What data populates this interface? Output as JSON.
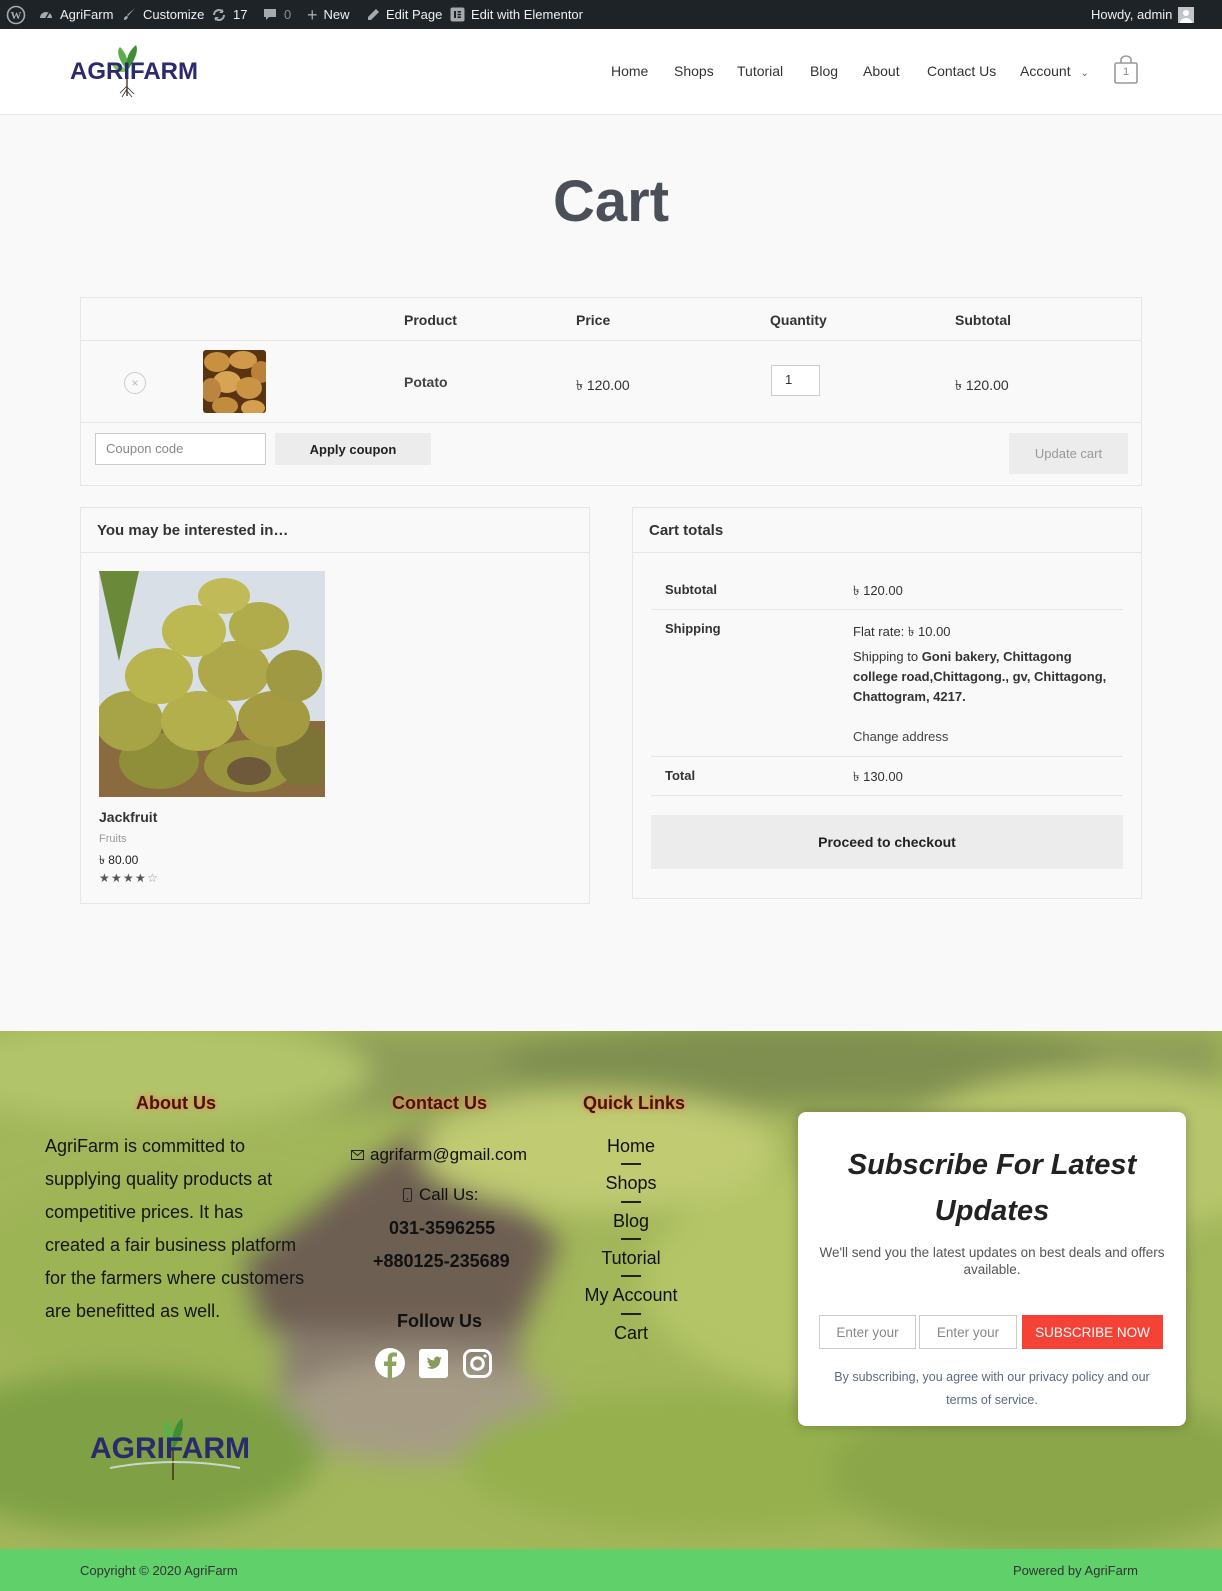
{
  "adminbar": {
    "site_name": "AgriFarm",
    "customize": "Customize",
    "updates_count": "17",
    "comments_count": "0",
    "new_label": "New",
    "edit_page": "Edit Page",
    "edit_elementor": "Edit with Elementor",
    "howdy": "Howdy, admin"
  },
  "header": {
    "logo_text": "AGRIFARM",
    "nav": [
      "Home",
      "Shops",
      "Tutorial",
      "Blog",
      "About",
      "Contact Us",
      "Account"
    ],
    "cart_count": "1"
  },
  "page_title": "Cart",
  "cart_table": {
    "headers": [
      "Product",
      "Price",
      "Quantity",
      "Subtotal"
    ],
    "row": {
      "remove_symbol": "×",
      "product": "Potato",
      "price": "৳ 120.00",
      "quantity": "1",
      "subtotal": "৳ 120.00"
    },
    "coupon_placeholder": "Coupon code",
    "apply_coupon": "Apply coupon",
    "update_cart": "Update cart"
  },
  "interested": {
    "title": "You may be interested in…",
    "product": {
      "name": "Jackfruit",
      "category": "Fruits",
      "price": "৳ 80.00",
      "rating": 4,
      "rating_max": 5
    }
  },
  "cart_totals": {
    "title": "Cart totals",
    "subtotal_label": "Subtotal",
    "subtotal_value": "৳ 120.00",
    "shipping_label": "Shipping",
    "flat_rate_label": "Flat rate:",
    "flat_rate_value": "৳ 10.00",
    "shipping_to_label": "Shipping to",
    "shipping_address": "Goni bakery, Chittagong college road,Chittagong., gv, Chittagong, Chattogram, 4217.",
    "change_address": "Change address",
    "total_label": "Total",
    "total_value": "৳ 130.00",
    "checkout_button": "Proceed to checkout"
  },
  "footer": {
    "about_title": "About Us",
    "about_text": "AgriFarm is committed to supplying quality products at competitive prices. It has created a fair business platform for the farmers where customers are benefitted as well.",
    "contact_title": "Contact Us",
    "email": "agrifarm@gmail.com",
    "call_label": "Call Us:",
    "phone1": "031-3596255",
    "phone2": "+880125-235689",
    "follow_title": "Follow Us",
    "quick_title": "Quick Links",
    "quick_links": [
      "Home",
      "Shops",
      "Blog",
      "Tutorial",
      "My Account",
      "Cart"
    ],
    "logo_text": "AGRIFARM"
  },
  "subscribe": {
    "title": "Subscribe For Latest Updates",
    "subtitle": "We'll send you the latest updates on best deals and offers available.",
    "input1_placeholder": "Enter your",
    "input2_placeholder": "Enter your",
    "button": "SUBSCRIBE NOW",
    "terms": "By subscribing, you agree with our privacy policy and our terms of service."
  },
  "copyright": {
    "left": "Copyright © 2020 AgriFarm",
    "right": "Powered by AgriFarm"
  },
  "colors": {
    "admin_bar": "#1d2327",
    "footer_bar": "#5fd06a",
    "subscribe_button": "#f44336",
    "title_gray": "#4a4f58"
  }
}
